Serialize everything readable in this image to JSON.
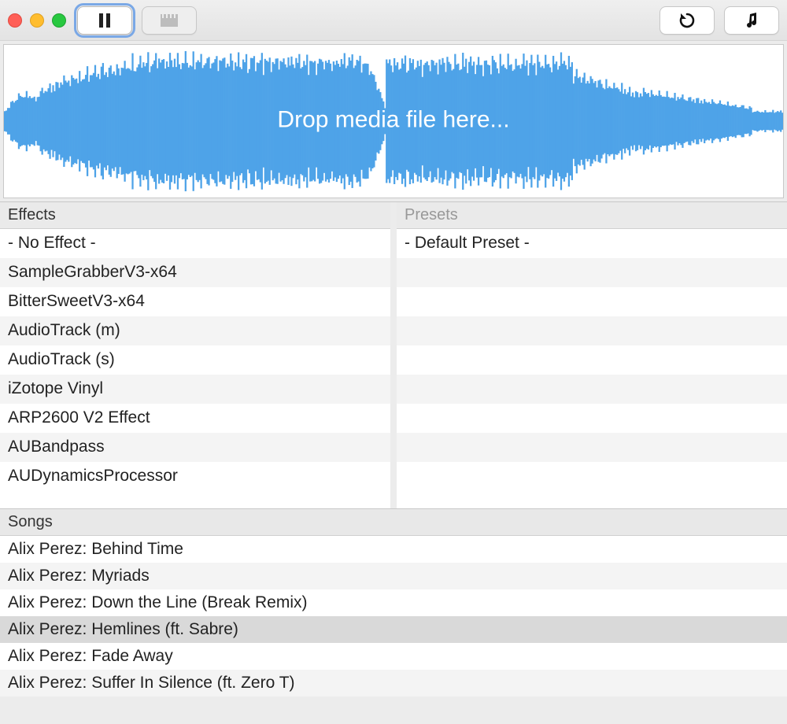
{
  "waveform": {
    "drop_text": "Drop media file here..."
  },
  "toolbar": {
    "pause_label": "Pause",
    "project_label": "Project",
    "reload_label": "Reload",
    "note_label": "Note"
  },
  "effects": {
    "header": "Effects",
    "items": [
      "- No Effect -",
      "SampleGrabberV3-x64",
      "BitterSweetV3-x64",
      "AudioTrack (m)",
      "AudioTrack (s)",
      "iZotope Vinyl",
      "ARP2600 V2 Effect",
      "AUBandpass",
      "AUDynamicsProcessor"
    ]
  },
  "presets": {
    "header": "Presets",
    "items": [
      "- Default Preset -",
      "",
      "",
      "",
      "",
      "",
      "",
      "",
      ""
    ]
  },
  "songs": {
    "header": "Songs",
    "selected_index": 3,
    "items": [
      "Alix Perez: Behind Time",
      "Alix Perez: Myriads",
      "Alix Perez: Down the Line (Break Remix)",
      "Alix Perez: Hemlines (ft. Sabre)",
      "Alix Perez: Fade Away",
      "Alix Perez: Suffer In Silence (ft. Zero T)"
    ]
  },
  "colors": {
    "waveform": "#4ea3e8"
  }
}
